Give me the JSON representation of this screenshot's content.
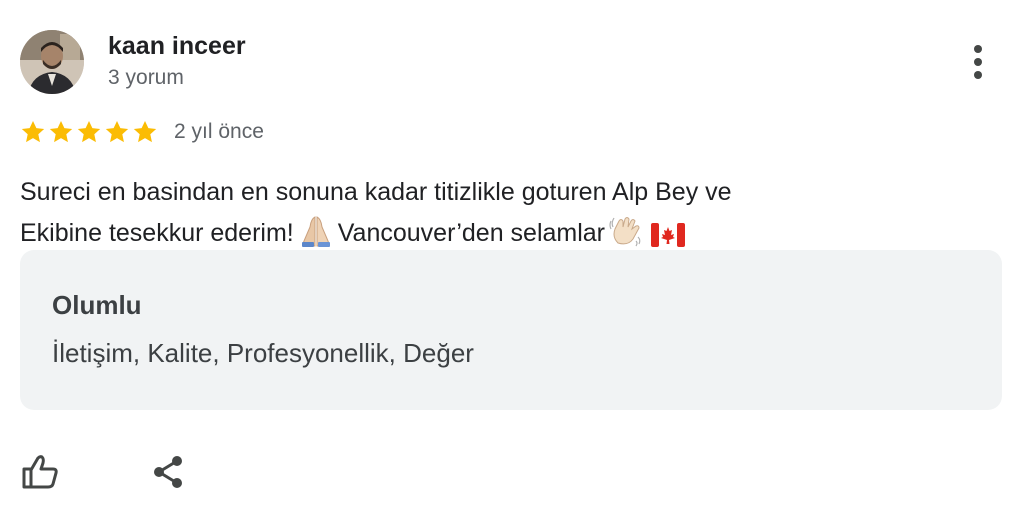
{
  "review": {
    "author_name": "kaan inceer",
    "author_review_count": "3 yorum",
    "rating": 5,
    "rating_max": 5,
    "star_color": "#fbbc04",
    "date": "2 yıl önce",
    "text_line_1": "Sureci en basindan en sonuna kadar titizlikle goturen Alp Bey ve",
    "text_line_2a": "Ekibine tesekkur ederim!",
    "text_line_2b": "Vancouver’den selamlar",
    "emojis": [
      "folded-hands-emoji",
      "waving-hand-emoji",
      "canada-flag-emoji"
    ]
  },
  "attributes": {
    "title": "Olumlu",
    "values": "İletişim, Kalite, Profesyonellik, Değer",
    "background": "#f1f3f4"
  },
  "actions": {
    "like_icon": "thumbs-up-icon",
    "share_icon": "share-icon",
    "more_icon": "more-vert-icon"
  }
}
